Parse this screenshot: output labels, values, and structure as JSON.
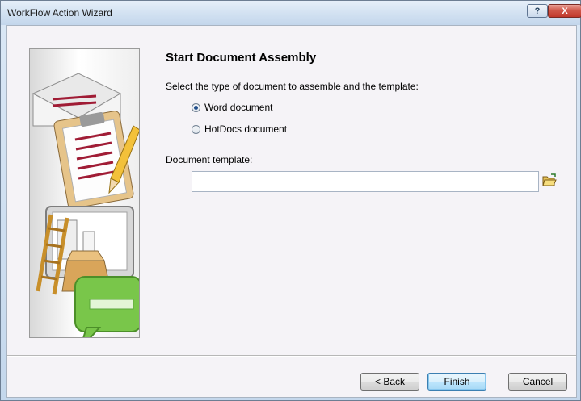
{
  "window": {
    "title": "WorkFlow Action Wizard",
    "help_label": "?",
    "close_label": "X"
  },
  "page": {
    "heading": "Start Document Assembly",
    "instruction": "Select the type of document to assemble and the template:",
    "options": [
      {
        "label": "Word document",
        "selected": true
      },
      {
        "label": "HotDocs document",
        "selected": false
      }
    ],
    "template_label": "Document template:",
    "template_value": ""
  },
  "buttons": {
    "back": "< Back",
    "finish": "Finish",
    "cancel": "Cancel"
  },
  "colors": {
    "accent_blue": "#214e8c",
    "close_red": "#c0382b",
    "panel_background": "#f5f3f7"
  }
}
